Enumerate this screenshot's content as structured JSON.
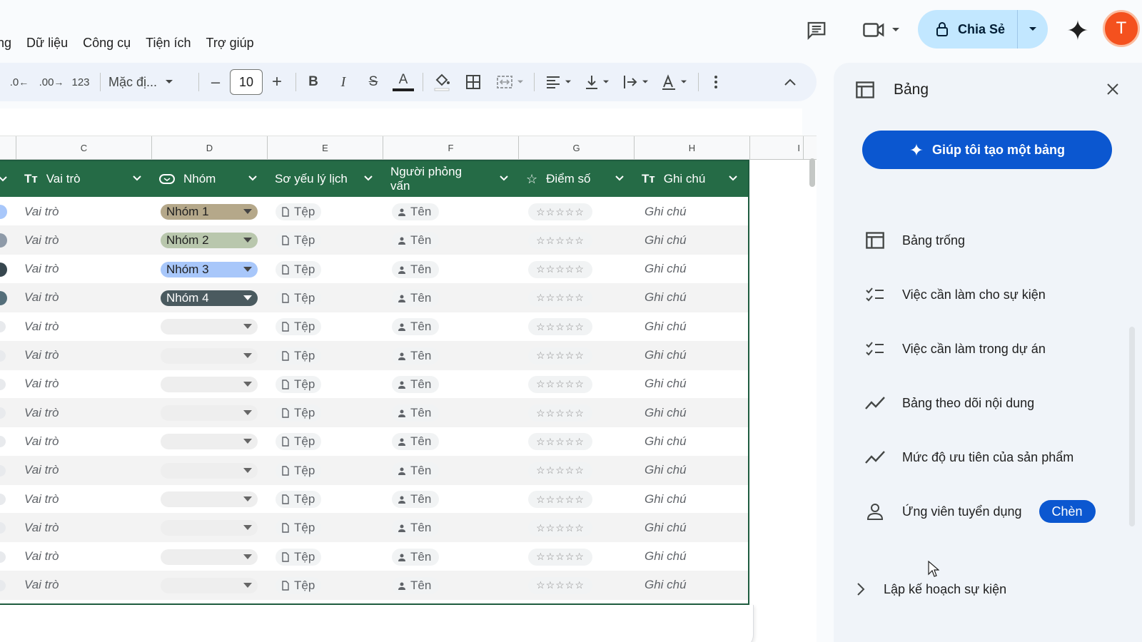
{
  "menu": [
    "ng",
    "Dữ liệu",
    "Công cụ",
    "Tiện ích",
    "Trợ giúp"
  ],
  "share": {
    "label": "Chia Sẻ"
  },
  "avatar": {
    "initial": "T",
    "color": "#f4511e"
  },
  "toolbar": {
    "dec_decrease": ".0",
    "dec_increase": ".00",
    "number_format": "123",
    "font": "Mặc đị...",
    "font_size": "10"
  },
  "columns": [
    "C",
    "D",
    "E",
    "F",
    "G",
    "H",
    "I"
  ],
  "table": {
    "headers": {
      "role": "Vai trò",
      "group": "Nhóm",
      "resume": "Sơ yếu lý lịch",
      "interviewer": "Người phỏng vấn",
      "score": "Điểm số",
      "note": "Ghi chú"
    },
    "rows": [
      {
        "role": "Vai trò",
        "group": "Nhóm 1",
        "group_color": "#b5a88a",
        "dot": "#a8c7fa",
        "file": "Tệp",
        "person": "Tên",
        "stars": "☆☆☆☆☆",
        "note": "Ghi chú"
      },
      {
        "role": "Vai trò",
        "group": "Nhóm 2",
        "group_color": "#b9c7ad",
        "dot": "#8e9aa8",
        "file": "Tệp",
        "person": "Tên",
        "stars": "☆☆☆☆☆",
        "note": "Ghi chú"
      },
      {
        "role": "Vai trò",
        "group": "Nhóm 3",
        "group_color": "#a8c7fa",
        "dot": "#37474f",
        "file": "Tệp",
        "person": "Tên",
        "stars": "☆☆☆☆☆",
        "note": "Ghi chú"
      },
      {
        "role": "Vai trò",
        "group": "Nhóm 4",
        "group_color": "#4a5a5f",
        "group_text": "#ffffff",
        "dot": "#546e7a",
        "file": "Tệp",
        "person": "Tên",
        "stars": "☆☆☆☆☆",
        "note": "Ghi chú"
      },
      {
        "role": "Vai trò",
        "group": "",
        "file": "Tệp",
        "person": "Tên",
        "stars": "☆☆☆☆☆",
        "note": "Ghi chú"
      },
      {
        "role": "Vai trò",
        "group": "",
        "file": "Tệp",
        "person": "Tên",
        "stars": "☆☆☆☆☆",
        "note": "Ghi chú"
      },
      {
        "role": "Vai trò",
        "group": "",
        "file": "Tệp",
        "person": "Tên",
        "stars": "☆☆☆☆☆",
        "note": "Ghi chú"
      },
      {
        "role": "Vai trò",
        "group": "",
        "file": "Tệp",
        "person": "Tên",
        "stars": "☆☆☆☆☆",
        "note": "Ghi chú"
      },
      {
        "role": "Vai trò",
        "group": "",
        "file": "Tệp",
        "person": "Tên",
        "stars": "☆☆☆☆☆",
        "note": "Ghi chú"
      },
      {
        "role": "Vai trò",
        "group": "",
        "file": "Tệp",
        "person": "Tên",
        "stars": "☆☆☆☆☆",
        "note": "Ghi chú"
      },
      {
        "role": "Vai trò",
        "group": "",
        "file": "Tệp",
        "person": "Tên",
        "stars": "☆☆☆☆☆",
        "note": "Ghi chú"
      },
      {
        "role": "Vai trò",
        "group": "",
        "file": "Tệp",
        "person": "Tên",
        "stars": "☆☆☆☆☆",
        "note": "Ghi chú"
      },
      {
        "role": "Vai trò",
        "group": "",
        "file": "Tệp",
        "person": "Tên",
        "stars": "☆☆☆☆☆",
        "note": "Ghi chú"
      },
      {
        "role": "Vai trò",
        "group": "",
        "file": "Tệp",
        "person": "Tên",
        "stars": "☆☆☆☆☆",
        "note": "Ghi chú"
      }
    ]
  },
  "panel": {
    "title": "Bảng",
    "ai_button": "Giúp tôi tạo một bảng",
    "items": [
      {
        "label": "Bảng trống",
        "icon": "table-icon"
      },
      {
        "label": "Việc cần làm cho sự kiện",
        "icon": "checklist-icon"
      },
      {
        "label": "Việc cần làm trong dự án",
        "icon": "checklist-icon"
      },
      {
        "label": "Bảng theo dõi nội dung",
        "icon": "trend-icon"
      },
      {
        "label": "Mức độ ưu tiên của sản phẩm",
        "icon": "trend-icon"
      },
      {
        "label": "Ứng viên tuyển dụng",
        "icon": "person-icon"
      }
    ],
    "insert_button": "Chèn",
    "section": "Lập kế hoạch sự kiện"
  },
  "colors": {
    "header_green": "#256b46",
    "accent_blue": "#0b57d0",
    "share_bg": "#c2e7ff"
  }
}
